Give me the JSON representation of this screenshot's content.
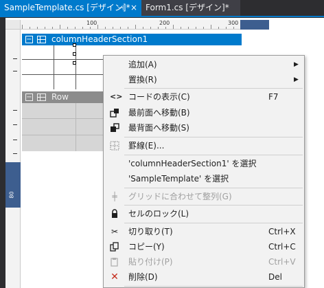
{
  "tabs": [
    {
      "label": "SampleTemplate.cs [デザイン]*",
      "active": true,
      "pin_glyph": "⊣",
      "close_glyph": "×"
    },
    {
      "label": "Form1.cs [デザイン]*",
      "active": false
    }
  ],
  "ruler": {
    "labels": [
      "100",
      "200",
      "300"
    ]
  },
  "vertical_ruler_label": "80",
  "sections": {
    "header": {
      "toggle": "−",
      "name": "columnHeaderSection1"
    },
    "row": {
      "toggle": "−",
      "name": "Row"
    }
  },
  "menu": {
    "items": [
      {
        "label": "追加(A)",
        "submenu": true,
        "icon": ""
      },
      {
        "label": "置換(R)",
        "submenu": true,
        "icon": ""
      },
      {
        "label": "コードの表示(C)",
        "shortcut": "F7",
        "icon": "code-icon"
      },
      {
        "label": "最前面へ移動(B)",
        "icon": "bring-to-front-icon"
      },
      {
        "label": "最背面へ移動(S)",
        "icon": "send-to-back-icon"
      },
      {
        "label": "罫線(E)...",
        "icon": "borders-icon"
      },
      {
        "label": "'columnHeaderSection1' を選択",
        "icon": ""
      },
      {
        "label": "'SampleTemplate' を選択",
        "icon": ""
      },
      {
        "label": "グリッドに合わせて整列(G)",
        "disabled": true,
        "icon": "align-grid-icon"
      },
      {
        "label": "セルのロック(L)",
        "icon": "lock-icon"
      },
      {
        "label": "切り取り(T)",
        "shortcut": "Ctrl+X",
        "icon": "cut-icon"
      },
      {
        "label": "コピー(Y)",
        "shortcut": "Ctrl+C",
        "icon": "copy-icon"
      },
      {
        "label": "貼り付け(P)",
        "shortcut": "Ctrl+V",
        "disabled": true,
        "icon": "paste-icon"
      },
      {
        "label": "削除(D)",
        "shortcut": "Del",
        "icon": "delete-icon"
      }
    ],
    "submenu_arrow": "▶",
    "icon_glyphs": {
      "code": "<>",
      "delete": "✕",
      "cut": "✂",
      "lock": "🔒",
      "align": "╪"
    }
  },
  "colors": {
    "accent": "#007acc",
    "delete_icon": "#c42b1c"
  }
}
